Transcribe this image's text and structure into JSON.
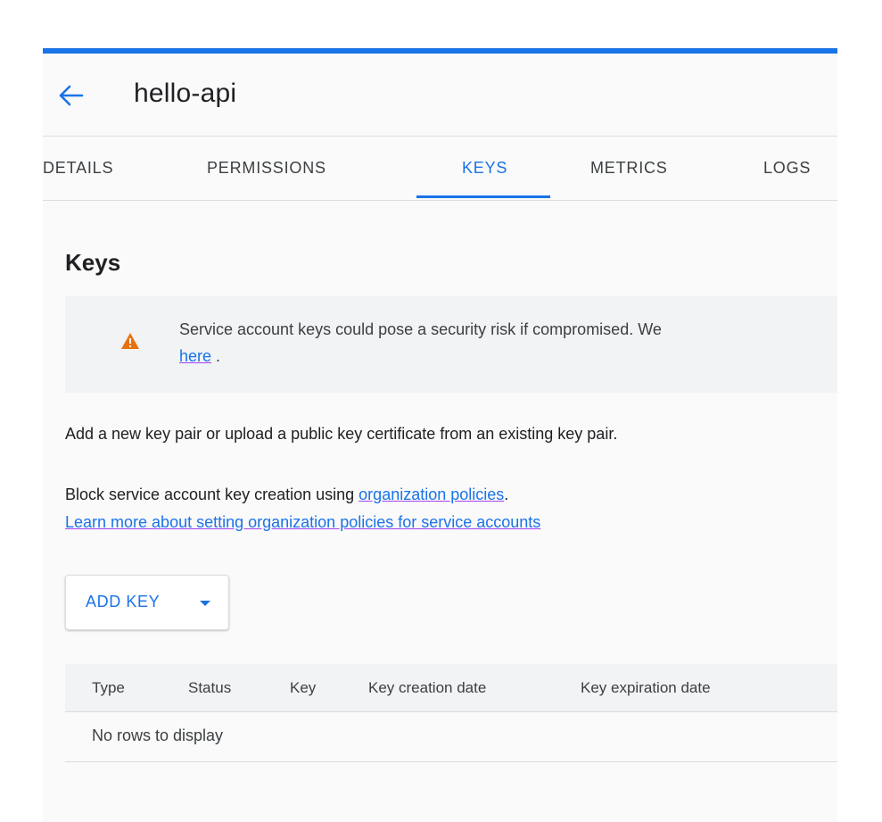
{
  "header": {
    "title": "hello-api"
  },
  "tabs": [
    {
      "label": "DETAILS",
      "active": false
    },
    {
      "label": "PERMISSIONS",
      "active": false
    },
    {
      "label": "KEYS",
      "active": true
    },
    {
      "label": "METRICS",
      "active": false
    },
    {
      "label": "LOGS",
      "active": false
    }
  ],
  "keys_section": {
    "title": "Keys",
    "warning": {
      "text": "Service account keys could pose a security risk if compromised. We",
      "link_text": "here",
      "link_suffix": "."
    },
    "description": "Add a new key pair or upload a public key certificate from an existing key pair.",
    "block_text": "Block service account key creation using ",
    "block_link": "organization policies",
    "block_suffix": ".",
    "learn_more_link": "Learn more about setting organization policies for service accounts",
    "add_key_label": "ADD KEY"
  },
  "table": {
    "columns": [
      "Type",
      "Status",
      "Key",
      "Key creation date",
      "Key expiration date"
    ],
    "empty_message": "No rows to display"
  },
  "colors": {
    "accent": "#1a73e8",
    "warning": "#e8710a",
    "link_underline": "#a142f4"
  },
  "icons": {
    "back": "arrow-left-icon",
    "warning": "warning-triangle-icon",
    "dropdown": "caret-down-icon"
  }
}
